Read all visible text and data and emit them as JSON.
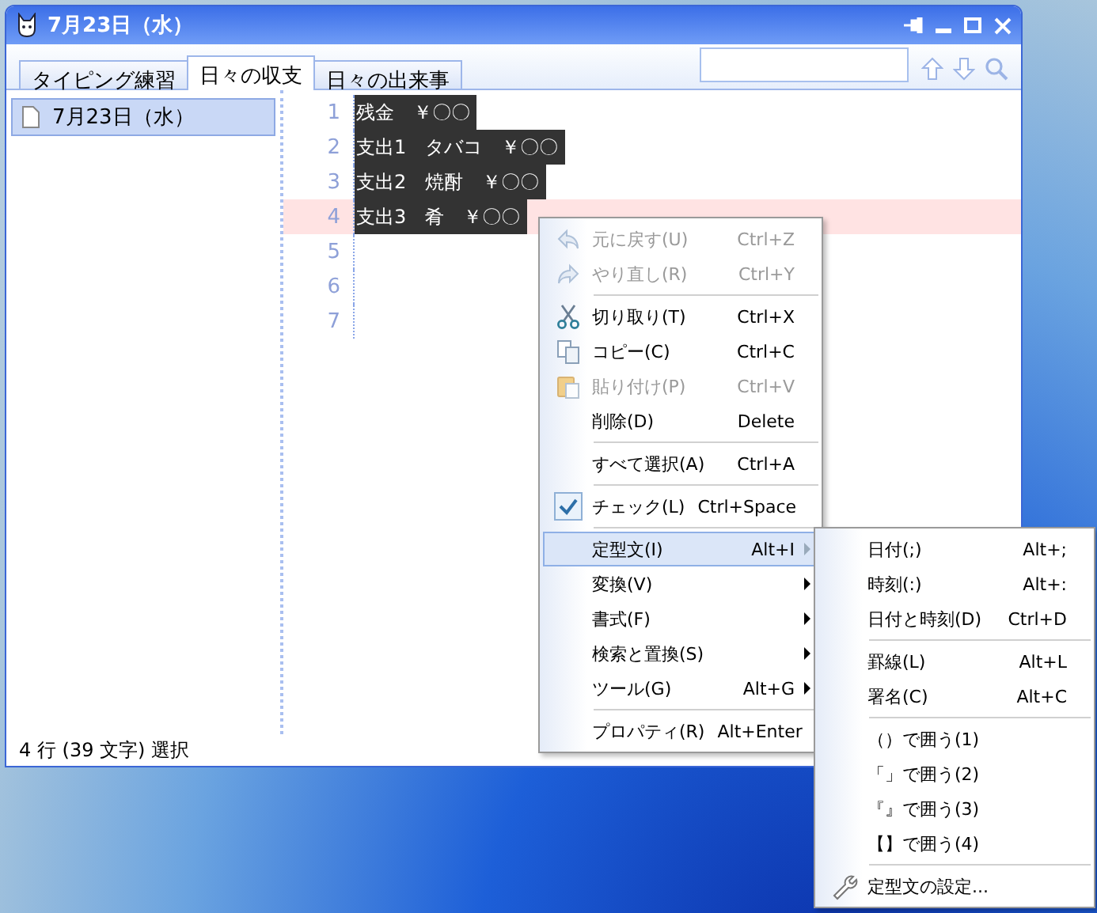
{
  "window": {
    "title": "7月23日（水）"
  },
  "tabs": [
    {
      "label": "タイピング練習",
      "selected": false
    },
    {
      "label": "日々の収支",
      "selected": true
    },
    {
      "label": "日々の出来事",
      "selected": false
    }
  ],
  "sidebar": {
    "items": [
      {
        "label": "7月23日（水）",
        "selected": true
      }
    ]
  },
  "editor": {
    "lines": [
      {
        "number": "1",
        "text": "残金　￥〇〇",
        "selected": true,
        "current": false
      },
      {
        "number": "2",
        "text": "支出1　タバコ　￥〇〇",
        "selected": true,
        "current": false
      },
      {
        "number": "3",
        "text": "支出2　焼酎　￥〇〇",
        "selected": true,
        "current": false
      },
      {
        "number": "4",
        "text": "支出3　肴　￥〇〇",
        "selected": true,
        "current": true
      },
      {
        "number": "5",
        "current": false
      },
      {
        "number": "6",
        "current": false
      },
      {
        "number": "7",
        "current": false
      }
    ]
  },
  "status_bar": "4 行 (39 文字) 選択",
  "context_menu": {
    "items": [
      {
        "kind": "item",
        "label": "元に戻す(U)",
        "shortcut": "Ctrl+Z",
        "disabled": true,
        "selected": false
      },
      {
        "kind": "item",
        "label": "やり直し(R)",
        "shortcut": "Ctrl+Y",
        "disabled": true,
        "selected": false
      },
      {
        "kind": "separator"
      },
      {
        "kind": "item",
        "label": "切り取り(T)",
        "shortcut": "Ctrl+X",
        "disabled": false,
        "selected": false
      },
      {
        "kind": "item",
        "label": "コピー(C)",
        "shortcut": "Ctrl+C",
        "disabled": false,
        "selected": false
      },
      {
        "kind": "item",
        "label": "貼り付け(P)",
        "shortcut": "Ctrl+V",
        "disabled": true,
        "selected": false
      },
      {
        "kind": "item",
        "label": "削除(D)",
        "shortcut": "Delete",
        "disabled": false,
        "selected": false
      },
      {
        "kind": "separator"
      },
      {
        "kind": "item",
        "label": "すべて選択(A)",
        "shortcut": "Ctrl+A",
        "disabled": false,
        "selected": false
      },
      {
        "kind": "separator"
      },
      {
        "kind": "check",
        "label": "チェック(L)",
        "shortcut": "Ctrl+Space",
        "checked": true,
        "disabled": false,
        "selected": false
      },
      {
        "kind": "separator"
      },
      {
        "kind": "submenu",
        "label": "定型文(I)",
        "shortcut": "Alt+I",
        "disabled": false,
        "selected": true
      },
      {
        "kind": "submenu",
        "label": "変換(V)",
        "disabled": false,
        "selected": false
      },
      {
        "kind": "submenu",
        "label": "書式(F)",
        "disabled": false,
        "selected": false
      },
      {
        "kind": "submenu",
        "label": "検索と置換(S)",
        "disabled": false,
        "selected": false
      },
      {
        "kind": "submenu",
        "label": "ツール(G)",
        "shortcut": "Alt+G",
        "disabled": false,
        "selected": false
      },
      {
        "kind": "separator"
      },
      {
        "kind": "item",
        "label": "プロパティ(R)",
        "shortcut": "Alt+Enter",
        "disabled": false,
        "selected": false
      }
    ]
  },
  "submenu": {
    "items": [
      {
        "kind": "item",
        "label": "日付(;)",
        "shortcut": "Alt+;",
        "disabled": false,
        "selected": false
      },
      {
        "kind": "item",
        "label": "時刻(:)",
        "shortcut": "Alt+:",
        "disabled": false,
        "selected": false
      },
      {
        "kind": "item",
        "label": "日付と時刻(D)",
        "shortcut": "Ctrl+D",
        "disabled": false,
        "selected": false
      },
      {
        "kind": "separator"
      },
      {
        "kind": "item",
        "label": "罫線(L)",
        "shortcut": "Alt+L",
        "disabled": false,
        "selected": false
      },
      {
        "kind": "item",
        "label": "署名(C)",
        "shortcut": "Alt+C",
        "disabled": false,
        "selected": false
      },
      {
        "kind": "separator"
      },
      {
        "kind": "item",
        "label": "（）で囲う(1)",
        "disabled": false,
        "selected": false
      },
      {
        "kind": "item",
        "label": "「」で囲う(2)",
        "disabled": false,
        "selected": false
      },
      {
        "kind": "item",
        "label": "『』で囲う(3)",
        "disabled": false,
        "selected": false
      },
      {
        "kind": "item",
        "label": "【】で囲う(4)",
        "disabled": false,
        "selected": false
      },
      {
        "kind": "separator"
      },
      {
        "kind": "item",
        "label": "定型文の設定...",
        "disabled": false,
        "selected": false
      }
    ]
  }
}
